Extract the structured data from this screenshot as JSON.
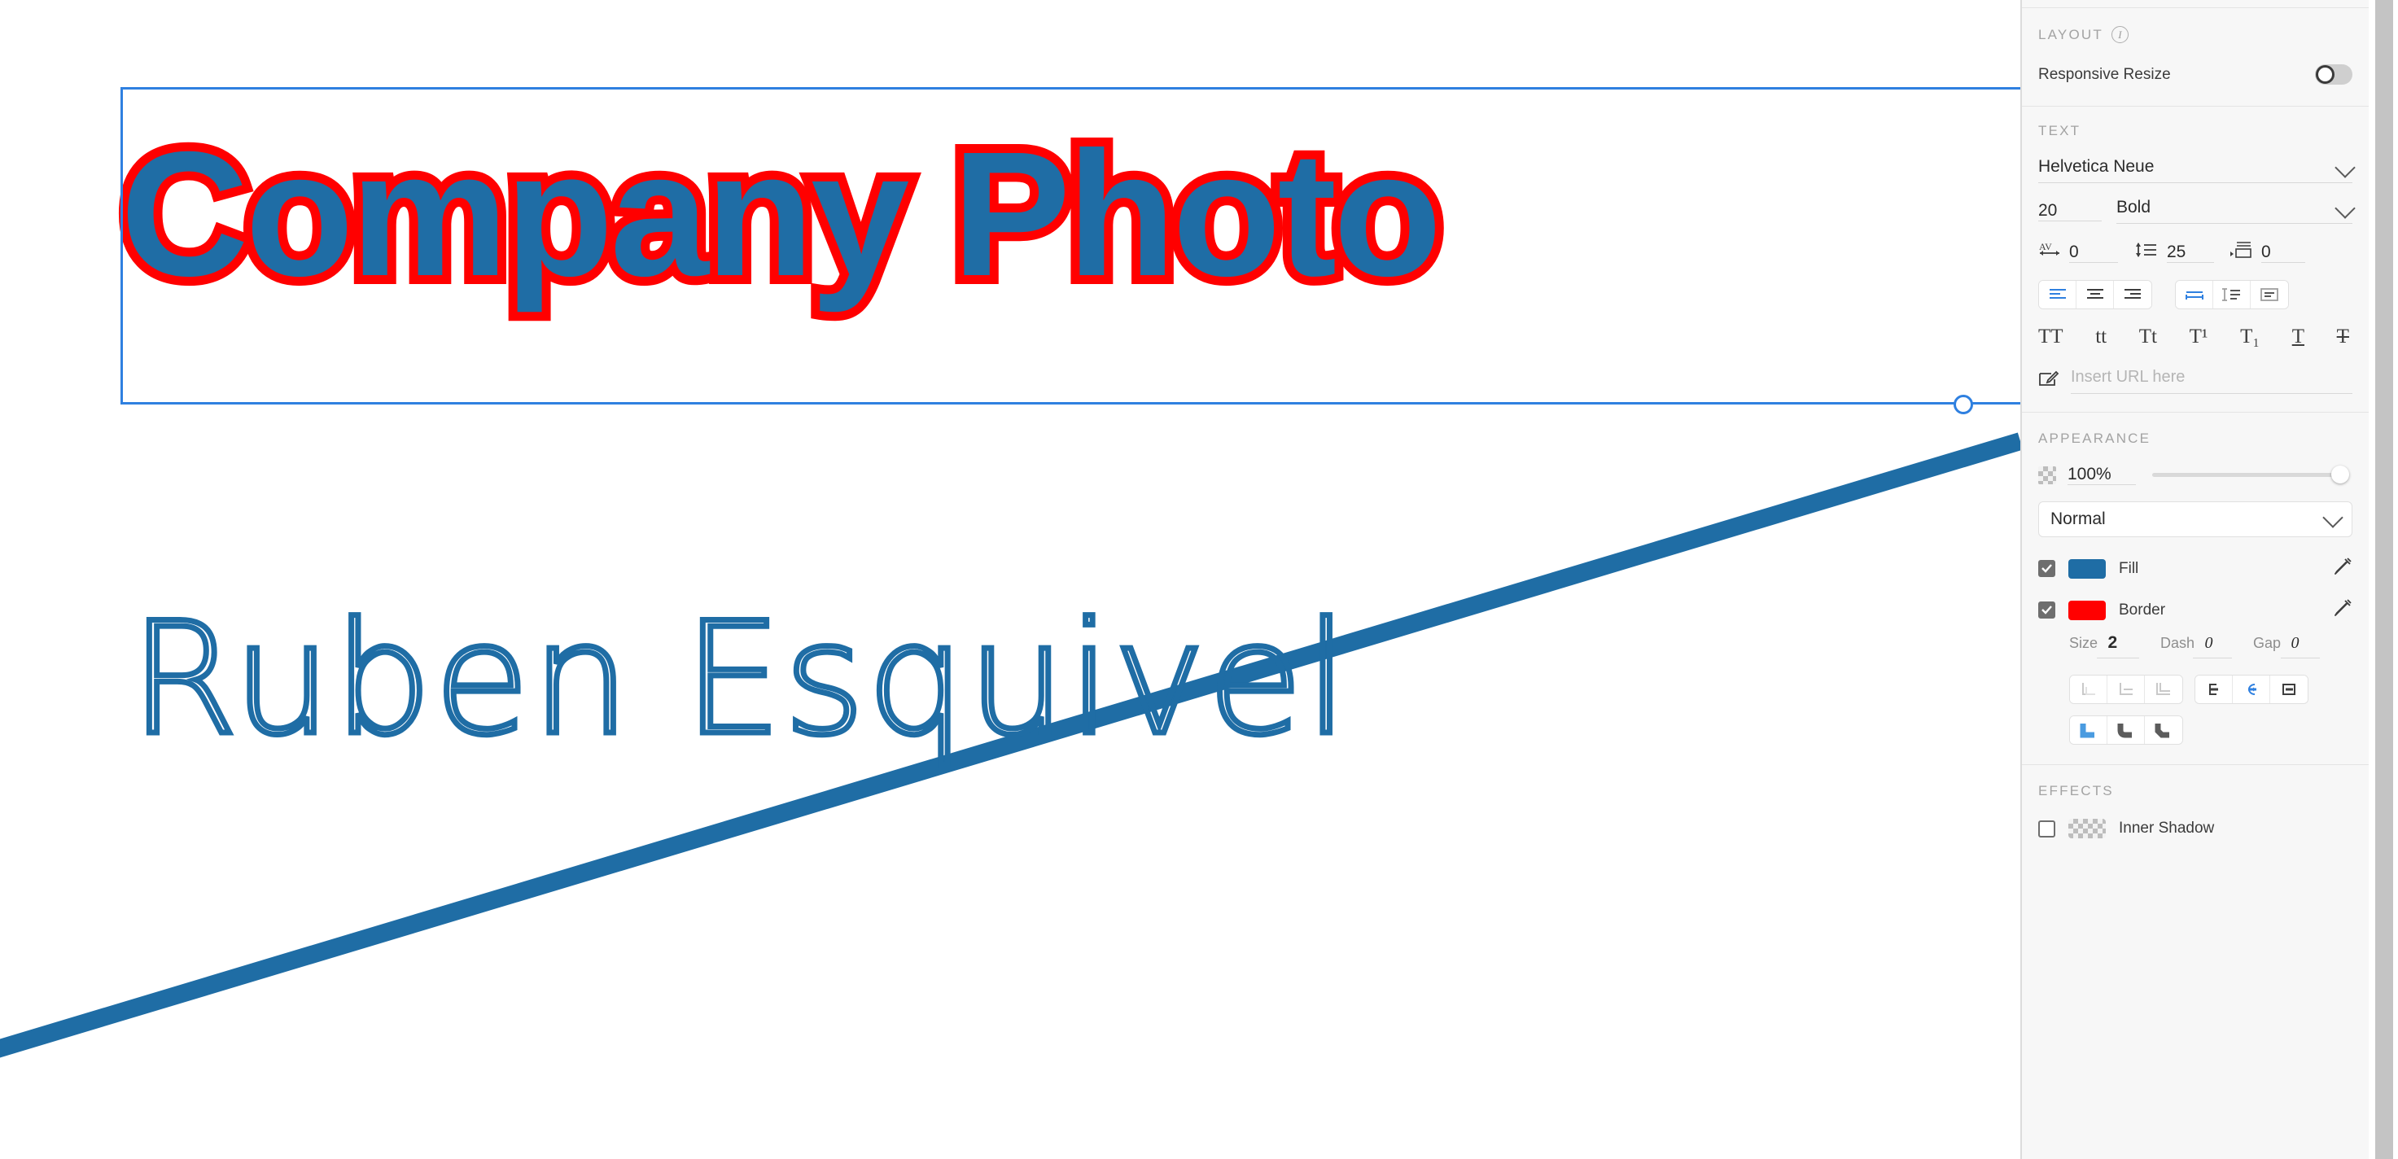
{
  "canvas": {
    "headline_text": "Company Photo",
    "subline_text": "Ruben Esquivel",
    "headline_fill_color": "#1F6DA5",
    "headline_stroke_color": "#FF0000",
    "subline_stroke_color": "#1F6DA5",
    "selection_color": "#2F80E0",
    "diagonal_line_color": "#1F6DA5"
  },
  "panel": {
    "layout": {
      "title": "LAYOUT",
      "info_icon": "info-icon",
      "responsive_resize_label": "Responsive Resize",
      "responsive_resize_on": false
    },
    "text": {
      "title": "TEXT",
      "font_family": "Helvetica Neue",
      "font_size": "20",
      "font_weight": "Bold",
      "letter_spacing_icon": "letter-spacing-icon",
      "letter_spacing": "0",
      "line_height_icon": "line-height-icon",
      "line_height": "25",
      "paragraph_indent_icon": "paragraph-indent-icon",
      "paragraph_indent": "0",
      "align_buttons": [
        {
          "name": "align-left-icon",
          "active": true
        },
        {
          "name": "align-center-icon",
          "active": false
        },
        {
          "name": "align-right-icon",
          "active": false
        }
      ],
      "resize_buttons": [
        {
          "name": "auto-width-icon",
          "active": true
        },
        {
          "name": "auto-height-icon",
          "active": false
        },
        {
          "name": "fixed-size-icon",
          "active": false
        }
      ],
      "case_buttons": [
        {
          "name": "uppercase-icon",
          "label": "TT"
        },
        {
          "name": "lowercase-icon",
          "label": "tt"
        },
        {
          "name": "titlecase-icon",
          "label": "Tt"
        },
        {
          "name": "superscript-icon",
          "label": "T¹"
        },
        {
          "name": "subscript-icon",
          "label": "T₁"
        },
        {
          "name": "underline-icon",
          "label": "T"
        },
        {
          "name": "strikethrough-icon",
          "label": "T"
        }
      ],
      "url_icon": "link-edit-icon",
      "url_placeholder": "Insert URL here",
      "url_value": ""
    },
    "appearance": {
      "title": "APPEARANCE",
      "opacity_icon": "opacity-checker-icon",
      "opacity_value": "100%",
      "opacity_percent": 100,
      "blend_mode": "Normal",
      "fill": {
        "label": "Fill",
        "enabled": true,
        "color": "#1F6DA5",
        "eyedropper_icon": "eyedropper-icon"
      },
      "border": {
        "label": "Border",
        "enabled": true,
        "color": "#FF0000",
        "eyedropper_icon": "eyedropper-icon",
        "size_label": "Size",
        "size_value": "2",
        "dash_label": "Dash",
        "dash_value": "0",
        "gap_label": "Gap",
        "gap_value": "0",
        "position_buttons": [
          {
            "name": "border-inside-icon",
            "active": false
          },
          {
            "name": "border-center-icon",
            "active": false
          },
          {
            "name": "border-outside-icon",
            "active": false
          }
        ],
        "cap_buttons": [
          {
            "name": "cap-butt-icon",
            "active": false
          },
          {
            "name": "cap-round-icon",
            "active": true
          },
          {
            "name": "cap-square-icon",
            "active": false
          }
        ],
        "join_buttons": [
          {
            "name": "join-miter-icon",
            "active": true
          },
          {
            "name": "join-round-icon",
            "active": false
          },
          {
            "name": "join-bevel-icon",
            "active": false
          }
        ]
      }
    },
    "effects": {
      "title": "EFFECTS",
      "inner_shadow": {
        "label": "Inner Shadow",
        "enabled": false,
        "swatch_icon": "transparent-swatch-icon"
      }
    }
  }
}
